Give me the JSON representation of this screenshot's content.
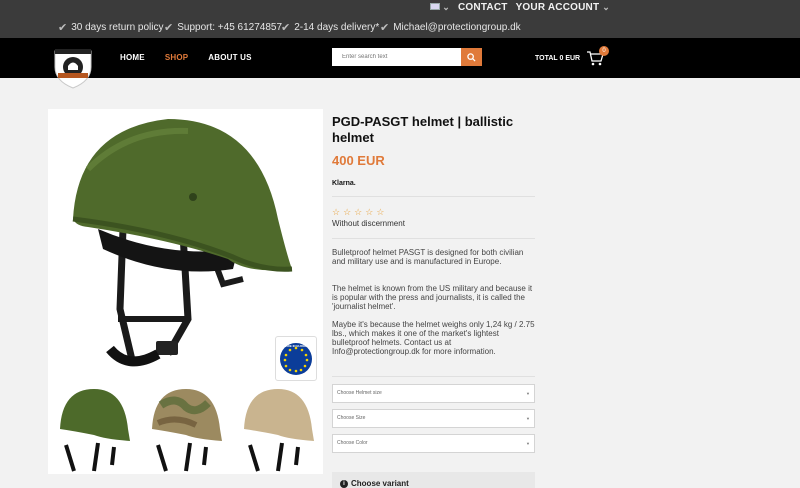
{
  "topbar": {
    "usps": [
      {
        "icon": "checkmark-icon",
        "text": "30 days return policy"
      },
      {
        "icon": "checkmark-icon",
        "text": "Support: +45 61274857"
      },
      {
        "icon": "checkmark-icon",
        "text": "2-14 days delivery*"
      },
      {
        "icon": "checkmark-icon",
        "text": "Michael@protectiongroup.dk"
      }
    ],
    "contact": "CONTACT",
    "account": "YOUR ACCOUNT"
  },
  "header": {
    "nav": [
      "HOME",
      "SHOP",
      "ABOUT US"
    ],
    "active_nav": "SHOP",
    "search_placeholder": "Enter search text",
    "total": "TOTAL 0 EUR",
    "cart_count": "0",
    "accent_color": "#e07a3a"
  },
  "product": {
    "title": "PGD-PASGT helmet | ballistic helmet",
    "price": "400 EUR",
    "payment": "Klarna.",
    "rating_text": "Without discernment",
    "description": [
      "Bulletproof helmet PASGT is designed for both civilian and military use and is manufactured in Europe.",
      "The helmet is known from the US military and because it is popular with the press and journalists, it is called the 'journalist helmet'.",
      "Maybe it's because the helmet weighs only 1,24 kg / 2.75 lbs., which makes it one of the market's lightest bulletproof helmets. Contact us at Info@protectiongroup.dk for more information."
    ],
    "selects": [
      "Choose Helmet size",
      "Choose Size",
      "Choose Color"
    ],
    "variant_label": "Choose variant",
    "badge_text": "MADE IN EUROPE",
    "thumbnails": [
      "green-helmet",
      "camo-helmet",
      "tan-helmet"
    ]
  }
}
